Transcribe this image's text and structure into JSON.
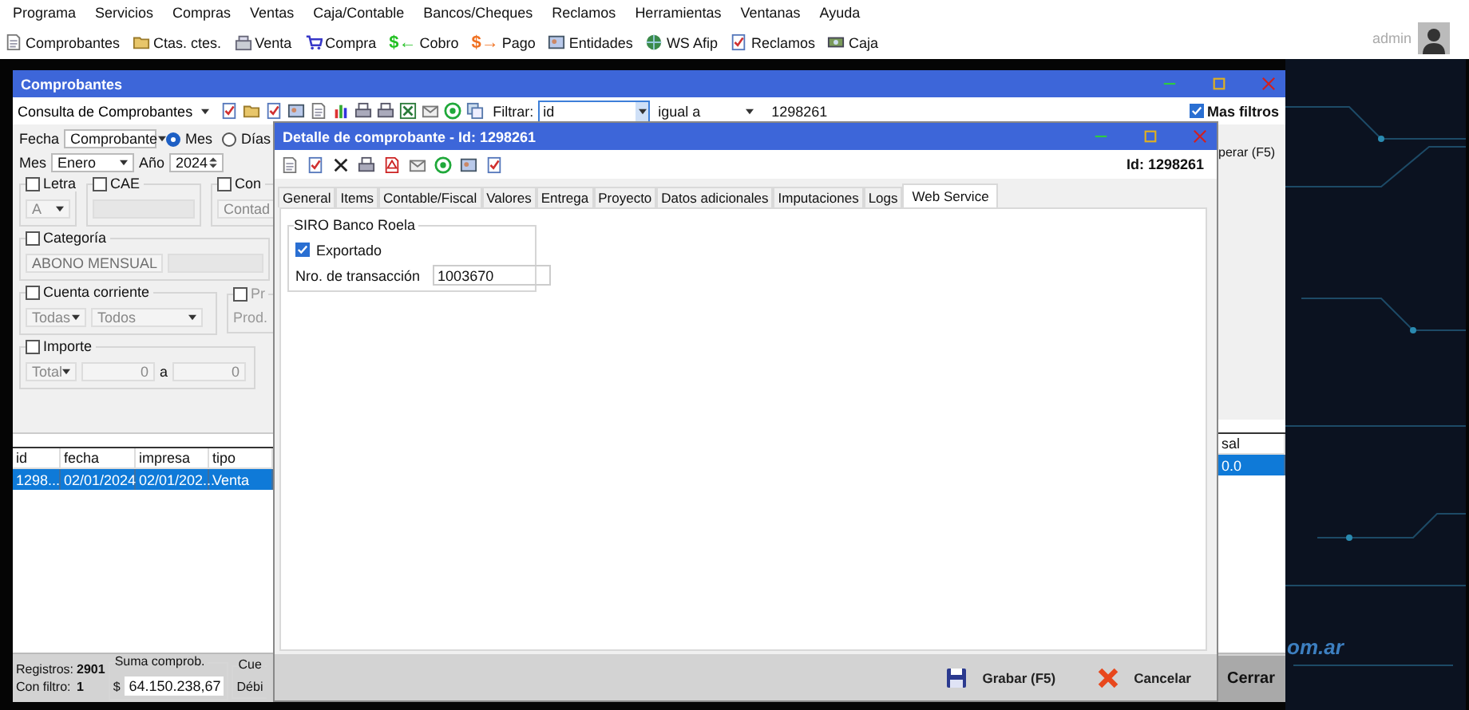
{
  "menu_bar": [
    "Programa",
    "Servicios",
    "Compras",
    "Ventas",
    "Caja/Contable",
    "Bancos/Cheques",
    "Reclamos",
    "Herramientas",
    "Ventanas",
    "Ayuda"
  ],
  "toolbar": [
    {
      "label": "Comprobantes"
    },
    {
      "label": "Ctas. ctes."
    },
    {
      "label": "Venta"
    },
    {
      "label": "Compra"
    },
    {
      "label": "Cobro",
      "glyph": "$←"
    },
    {
      "label": "Pago",
      "glyph": "$→"
    },
    {
      "label": "Entidades"
    },
    {
      "label": "WS Afip"
    },
    {
      "label": "Reclamos"
    },
    {
      "label": "Caja"
    }
  ],
  "user": {
    "name": "admin"
  },
  "main_window": {
    "title": "Comprobantes",
    "query_selector": "Consulta de Comprobantes",
    "filter": {
      "label": "Filtrar:",
      "field": "id",
      "operator": "igual a",
      "value": "1298261"
    },
    "more_filters": {
      "label": "Mas filtros",
      "checked": true
    },
    "filters": {
      "date_type_label": "Fecha",
      "date_type": "Comprobante",
      "period_options": [
        {
          "label": "Mes",
          "selected": true
        },
        {
          "label": "Días",
          "selected": false
        }
      ],
      "month_label": "Mes",
      "month": "Enero",
      "year_label": "Año",
      "year": "2024",
      "letra": {
        "label": "Letra",
        "checked": false,
        "value": "A"
      },
      "cae": {
        "label": "CAE",
        "checked": false
      },
      "group_3": {
        "label": "Con",
        "checked": false,
        "value": "Contad"
      },
      "categoria": {
        "label": "Categoría",
        "checked": false,
        "value": "ABONO MENSUAL"
      },
      "cuenta_corriente": {
        "label": "Cuenta corriente",
        "checked": false,
        "values": [
          "Todas",
          "Todos"
        ]
      },
      "group_6": {
        "label": "Pr",
        "checked": false,
        "field_label": "Prod."
      },
      "importe": {
        "label": "Importe",
        "checked": false,
        "type": "Total",
        "from": "0",
        "to_label": "a",
        "to": "0"
      }
    },
    "recover_button": "perar (F5)",
    "table": {
      "columns": [
        "id",
        "fecha",
        "impresa",
        "tipo"
      ],
      "rows": [
        {
          "cells": [
            "1298...",
            "02/01/2024",
            "02/01/202...",
            "Venta"
          ],
          "selected": true
        }
      ],
      "right_columns": [
        "sal"
      ],
      "right_rows": [
        {
          "cells": [
            "0.0"
          ],
          "selected": true
        }
      ]
    },
    "status_bar": {
      "records_label": "Registros:",
      "records": "2901",
      "filtered_label": "Con filtro:",
      "filtered": "1",
      "sum_label": "Suma comprob.",
      "currency": "$",
      "sum": "64.150.238,67",
      "group_3_label": "Cue",
      "group_3_text": "Débi"
    },
    "close_button": "Cerrar"
  },
  "dialog": {
    "title": "Detalle de comprobante - Id: 1298261",
    "id_label": "Id: 1298261",
    "tabs": [
      {
        "label": "General",
        "selected": false
      },
      {
        "label": "Items",
        "selected": false
      },
      {
        "label": "Contable/Fiscal",
        "selected": false
      },
      {
        "label": "Valores",
        "selected": false
      },
      {
        "label": "Entrega",
        "selected": false
      },
      {
        "label": "Proyecto",
        "selected": false
      },
      {
        "label": "Datos adicionales",
        "selected": false
      },
      {
        "label": "Imputaciones",
        "selected": false
      },
      {
        "label": "Logs",
        "selected": false
      },
      {
        "label": "Web Service",
        "selected": true
      }
    ],
    "group": {
      "title": "SIRO Banco Roela",
      "exported": {
        "label": "Exportado",
        "checked": true
      },
      "transaction": {
        "label": "Nro. de transacción",
        "value": "1003670"
      }
    },
    "buttons": {
      "save": "Grabar (F5)",
      "cancel": "Cancelar"
    }
  },
  "wallpaper_text": "om.ar"
}
